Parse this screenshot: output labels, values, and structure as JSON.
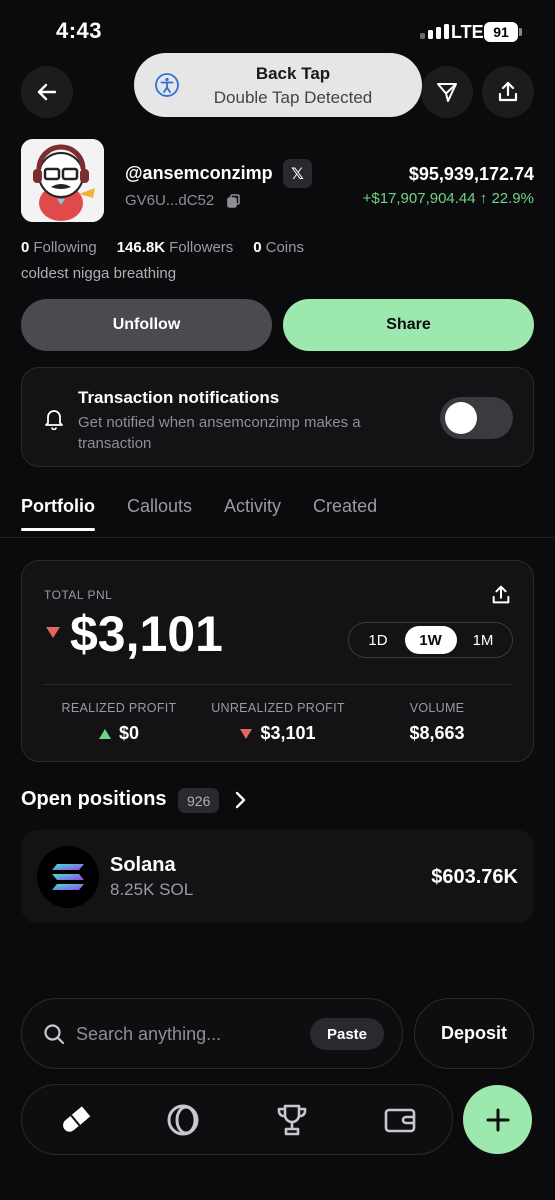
{
  "status_bar": {
    "time": "4:43",
    "network": "LTE",
    "battery": "91"
  },
  "toast": {
    "title": "Back Tap",
    "subtitle": "Double Tap Detected",
    "icon": "accessibility-icon"
  },
  "header": {
    "back_icon": "arrow-left-icon",
    "send_icon": "paper-plane-icon",
    "share_icon": "upload-icon"
  },
  "profile": {
    "username": "@ansemconzimp",
    "social_badge": "𝕏",
    "wallet": "GV6U...dC52",
    "balance": "$95,939,172.74",
    "change": "+$17,907,904.44 ↑ 22.9%",
    "stats": {
      "following_count": "0",
      "following_label": "Following",
      "followers_count": "146.8K",
      "followers_label": "Followers",
      "coins_count": "0",
      "coins_label": "Coins"
    },
    "bio": "coldest nigga breathing"
  },
  "actions": {
    "unfollow_label": "Unfollow",
    "share_label": "Share"
  },
  "notifications": {
    "title": "Transaction notifications",
    "description": "Get notified when ansemconzimp makes a transaction",
    "enabled": false
  },
  "tabs": [
    {
      "label": "Portfolio",
      "active": true
    },
    {
      "label": "Callouts",
      "active": false
    },
    {
      "label": "Activity",
      "active": false
    },
    {
      "label": "Created",
      "active": false
    }
  ],
  "pnl": {
    "label": "TOTAL PNL",
    "value": "$3,101",
    "direction": "down",
    "ranges": [
      "1D",
      "1W",
      "1M"
    ],
    "selected_range": "1W",
    "metrics": [
      {
        "label": "REALIZED PROFIT",
        "value": "$0",
        "direction": "up"
      },
      {
        "label": "UNREALIZED PROFIT",
        "value": "$3,101",
        "direction": "down"
      },
      {
        "label": "VOLUME",
        "value": "$8,663",
        "direction": "none"
      }
    ]
  },
  "positions": {
    "title": "Open positions",
    "count": "926",
    "items": [
      {
        "name": "Solana",
        "amount": "8.25K SOL",
        "value": "$603.76K",
        "icon": "solana-logo"
      }
    ]
  },
  "search": {
    "placeholder": "Search anything...",
    "paste_label": "Paste",
    "deposit_label": "Deposit"
  },
  "nav": {
    "items": [
      "pill-icon",
      "ring-icon",
      "trophy-icon",
      "wallet-icon"
    ],
    "fab_icon": "plus-icon"
  },
  "colors": {
    "accent_green": "#9ce8ae",
    "positive": "#6fd488",
    "negative": "#e0685e",
    "background": "#0b0b0d"
  }
}
